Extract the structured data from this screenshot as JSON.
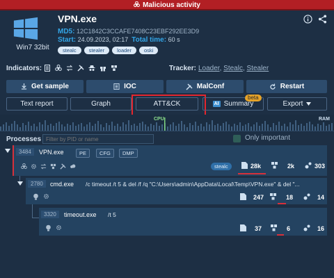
{
  "banner": {
    "text": "Malicious activity"
  },
  "header": {
    "os": "Win7 32bit",
    "filename": "VPN.exe",
    "md5_label": "MD5:",
    "md5": "12C1842C3CCAFE7408C23EBF292EE3D9",
    "start_label": "Start:",
    "start": "24.09.2023, 02:17",
    "total_label": "Total time:",
    "total": "60 s",
    "tags": [
      "stealc",
      "stealer",
      "loader",
      "oski"
    ]
  },
  "indicators": {
    "label": "Indicators:",
    "icons": [
      "document-icon",
      "biohazard-icon",
      "network-icon",
      "tools-icon",
      "spy-icon",
      "gift-icon",
      "registry-icon"
    ]
  },
  "tracker": {
    "label": "Tracker:",
    "links": [
      "Loader",
      "Stealc",
      "Stealer"
    ],
    "separator": ", "
  },
  "buttons": {
    "get_sample": "Get sample",
    "ioc": "IOC",
    "malconf": "MalConf",
    "restart": "Restart",
    "text_report": "Text report",
    "graph": "Graph",
    "attck": "ATT&CK",
    "ai": "AI",
    "summary": "Summary",
    "beta": "beta",
    "export": "Export"
  },
  "perf": {
    "cpu_label": "CPU",
    "ram_label": "RAM"
  },
  "processes": {
    "label": "Processes",
    "filter_placeholder": "Filter by PID or name",
    "only_important": "Only important",
    "rows": [
      {
        "pid": "3484",
        "name": "VPN.exe",
        "badges": [
          "PE",
          "CFG",
          "DMP"
        ],
        "tag": "stealc",
        "files": "28k",
        "reg": "2k",
        "net": "303"
      },
      {
        "pid": "2780",
        "name": "cmd.exe",
        "cmd": "/c timeout /t 5 & del /f /q \"C:\\Users\\admin\\AppData\\Local\\Temp\\VPN.exe\" & del \"...",
        "files": "247",
        "reg": "18",
        "net": "14"
      },
      {
        "pid": "3320",
        "name": "timeout.exe",
        "cmd": "/t 5",
        "files": "37",
        "reg": "6",
        "net": "16"
      }
    ]
  },
  "colors": {
    "banner": "#b21f24",
    "background": "#1d2f44",
    "accent": "#33a6e8",
    "highlight": "#e5262e"
  }
}
